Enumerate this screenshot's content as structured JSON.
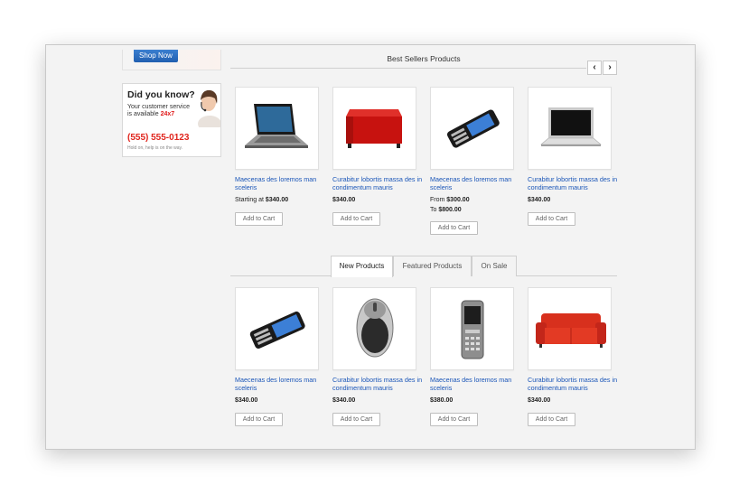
{
  "sidebar": {
    "shop_now": "Shop Now",
    "did_you_know": {
      "title": "Did you know?",
      "line1": "Your customer service",
      "line2_prefix": "is available ",
      "line2_highlight": "24x7",
      "phone": "(555) 555-0123",
      "hold": "Hold on, help is on the way."
    }
  },
  "best_sellers": {
    "title": "Best Sellers Products",
    "prev_icon": "chevron-left-icon",
    "next_icon": "chevron-right-icon",
    "products": [
      {
        "name": "Maecenas des loremos man sceleris",
        "icon": "laptop-icon",
        "price_line1_label": "Starting at ",
        "price_line1": "$340.00",
        "price_line2_label": "",
        "price_line2": "",
        "cart": "Add to Cart"
      },
      {
        "name": "Curabitur lobortis massa des in condimentum mauris",
        "icon": "ottoman-icon",
        "price_line1_label": "",
        "price_line1": "$340.00",
        "price_line2_label": "",
        "price_line2": "",
        "cart": "Add to Cart"
      },
      {
        "name": "Maecenas des loremos man sceleris",
        "icon": "phone-icon",
        "price_line1_label": "From ",
        "price_line1": "$300.00",
        "price_line2_label": "To ",
        "price_line2": "$800.00",
        "cart": "Add to Cart"
      },
      {
        "name": "Curabitur lobortis massa des in condimentum mauris",
        "icon": "notebook-icon",
        "price_line1_label": "",
        "price_line1": "$340.00",
        "price_line2_label": "",
        "price_line2": "",
        "cart": "Add to Cart"
      }
    ]
  },
  "tabs": {
    "items": [
      "New Products",
      "Featured Products",
      "On Sale"
    ],
    "active": "New Products"
  },
  "new_products": {
    "products": [
      {
        "name": "Maecenas des loremos man sceleris",
        "icon": "phone-icon",
        "price": "$340.00",
        "cart": "Add to Cart"
      },
      {
        "name": "Curabitur lobortis massa des in condimentum mauris",
        "icon": "mouse-icon",
        "price": "$340.00",
        "cart": "Add to Cart"
      },
      {
        "name": "Maecenas des loremos man sceleris",
        "icon": "mobile-phone-icon",
        "price": "$380.00",
        "cart": "Add to Cart"
      },
      {
        "name": "Curabitur lobortis massa des in condimentum mauris",
        "icon": "sofa-icon",
        "price": "$340.00",
        "cart": "Add to Cart"
      }
    ]
  },
  "colors": {
    "link": "#1b56b8",
    "accent_button": "#2a6cc2",
    "phone_red": "#e0241c"
  }
}
